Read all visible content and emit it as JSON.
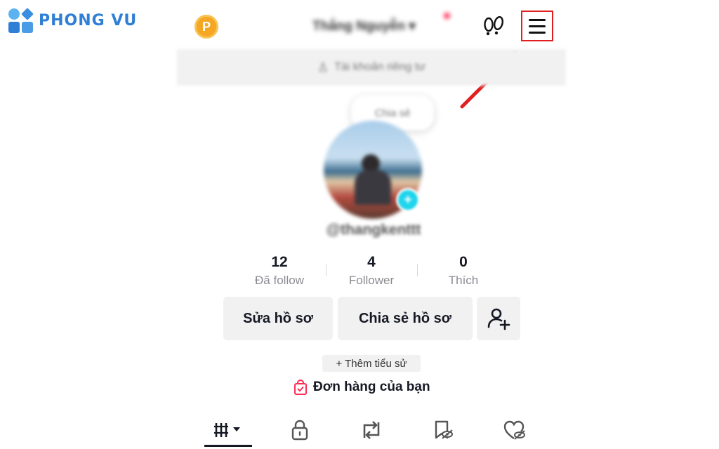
{
  "watermark": {
    "brand": "PHONG VU"
  },
  "topbar": {
    "coin_letter": "P",
    "username": "Thắng Nguyễn",
    "username_chevron": "▾",
    "icons": [
      "coin-icon",
      "footprints-icon",
      "hamburger-menu-icon"
    ]
  },
  "switch_account": {
    "label": "Tài khoản riêng tư"
  },
  "note_bubble": {
    "text": "Chia sẻ"
  },
  "profile": {
    "handle": "@thangkenttt",
    "add_badge": "+"
  },
  "stats": [
    {
      "value": "12",
      "label": "Đã follow"
    },
    {
      "value": "4",
      "label": "Follower"
    },
    {
      "value": "0",
      "label": "Thích"
    }
  ],
  "actions": {
    "edit_profile": "Sửa hồ sơ",
    "share_profile": "Chia sẻ hồ sơ"
  },
  "bio": {
    "add_label": "+ Thêm tiểu sử"
  },
  "orders": {
    "label": "Đơn hàng của bạn"
  },
  "tabs": [
    {
      "icon": "videos-grid-icon",
      "selected": true
    },
    {
      "icon": "lock-icon",
      "selected": false
    },
    {
      "icon": "repost-icon",
      "selected": false
    },
    {
      "icon": "favorites-icon",
      "selected": false
    },
    {
      "icon": "liked-icon",
      "selected": false
    }
  ],
  "colors": {
    "annotation_red": "#e02020",
    "brand_blue": "#2f7fd6",
    "coin": "#f5a623",
    "badge_cyan": "#20d5ec",
    "notification_dot": "#fe2c55"
  }
}
